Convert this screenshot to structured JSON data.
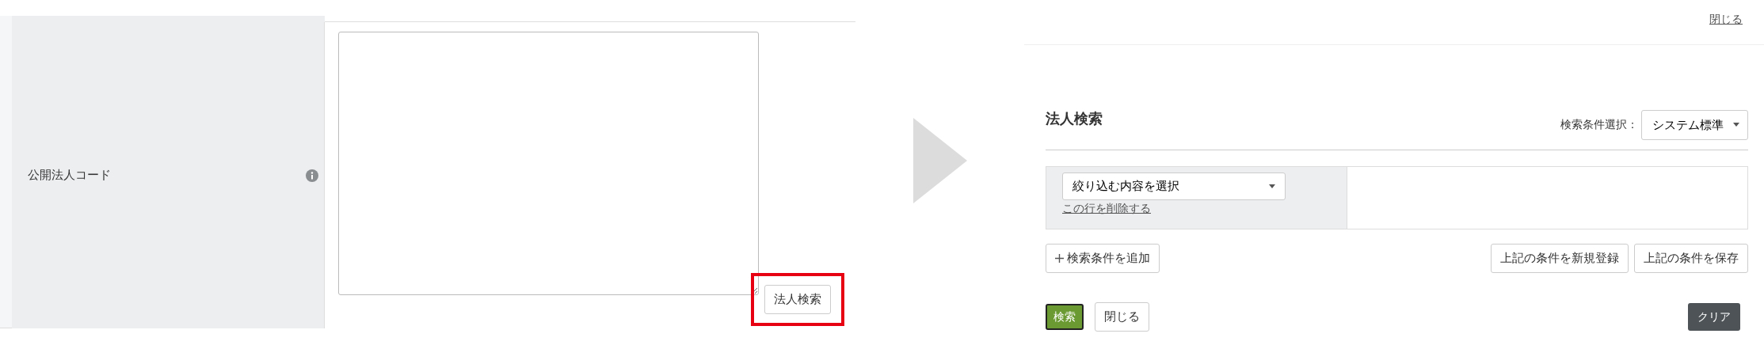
{
  "left_form": {
    "label": "公開法人コード",
    "button": "法人検索",
    "highlighted": true
  },
  "dialog": {
    "close_link": "閉じる",
    "title": "法人検索",
    "preset": {
      "label": "検索条件選択：",
      "value": "システム標準"
    },
    "filter_rows": [
      {
        "placeholder": "絞り込む内容を選択",
        "delete_link": "この行を削除する"
      }
    ],
    "add_button": "検索条件を追加",
    "save_new_button": "上記の条件を新規登録",
    "save_button": "上記の条件を保存",
    "search_button": "検索",
    "close_button": "閉じる",
    "clear_button": "クリア"
  }
}
